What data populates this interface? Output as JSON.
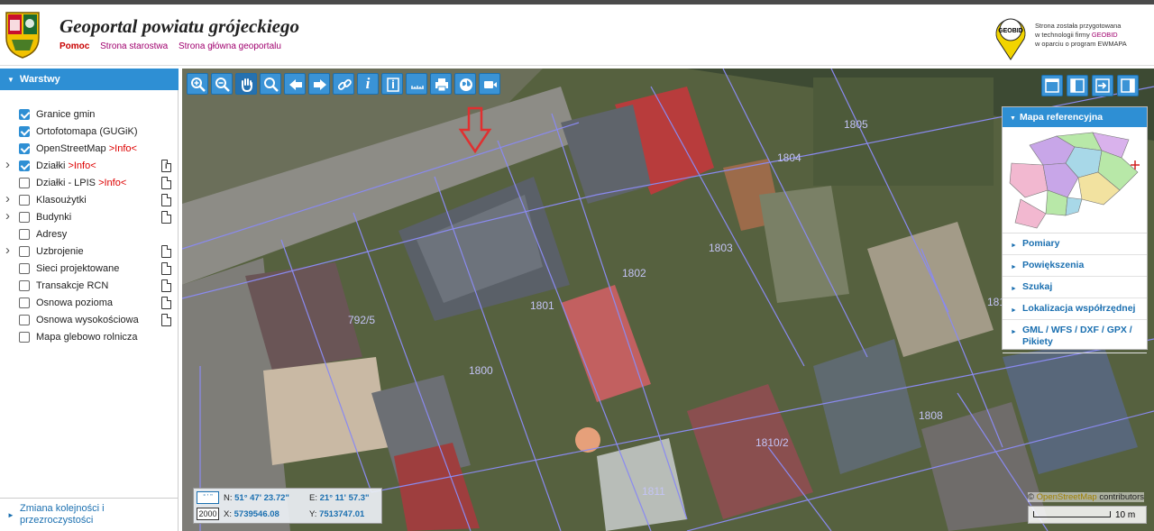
{
  "header": {
    "title": "Geoportal powiatu grójeckiego",
    "links": [
      "Pomoc",
      "Strona starostwa",
      "Strona główna geoportalu"
    ],
    "geobid_line1": "Strona została przygotowana",
    "geobid_line2_prefix": "w technologii firmy ",
    "geobid_brand": "GEOBID",
    "geobid_line3": "w oparciu o program EWMAPA",
    "geobid_logo_text": "GEOBID"
  },
  "sidebar": {
    "header": "Warstwy",
    "layers": [
      {
        "label": "Granice gmin",
        "info": "",
        "checked": true,
        "expandable": false,
        "doc": "none"
      },
      {
        "label": "Ortofotomapa (GUGiK)",
        "info": "",
        "checked": true,
        "expandable": false,
        "doc": "none"
      },
      {
        "label": "OpenStreetMap ",
        "info": ">Info<",
        "checked": true,
        "expandable": false,
        "doc": "none"
      },
      {
        "label": "Działki ",
        "info": ">Info<",
        "checked": true,
        "expandable": true,
        "doc": "info"
      },
      {
        "label": "Działki - LPIS ",
        "info": ">Info<",
        "checked": false,
        "expandable": false,
        "doc": "doc"
      },
      {
        "label": "Klasoużytki",
        "info": "",
        "checked": false,
        "expandable": true,
        "doc": "doc"
      },
      {
        "label": "Budynki",
        "info": "",
        "checked": false,
        "expandable": true,
        "doc": "doc"
      },
      {
        "label": "Adresy",
        "info": "",
        "checked": false,
        "expandable": false,
        "doc": "none"
      },
      {
        "label": "Uzbrojenie",
        "info": "",
        "checked": false,
        "expandable": true,
        "doc": "doc"
      },
      {
        "label": "Sieci projektowane",
        "info": "",
        "checked": false,
        "expandable": false,
        "doc": "doc"
      },
      {
        "label": "Transakcje RCN",
        "info": "",
        "checked": false,
        "expandable": false,
        "doc": "doc"
      },
      {
        "label": "Osnowa pozioma",
        "info": "",
        "checked": false,
        "expandable": false,
        "doc": "doc"
      },
      {
        "label": "Osnowa wysokościowa",
        "info": "",
        "checked": false,
        "expandable": false,
        "doc": "doc"
      },
      {
        "label": "Mapa glebowo rolnicza",
        "info": "",
        "checked": false,
        "expandable": false,
        "doc": "none"
      }
    ],
    "order_button_line1": "Zmiana kolejności i",
    "order_button_line2": "przezroczystości"
  },
  "toolbar": {
    "tools": [
      "zoom-in-icon",
      "zoom-out-icon",
      "pan-hand-icon",
      "zoom-window-icon",
      "back-arrow-icon",
      "forward-arrow-icon",
      "link-icon",
      "info-icon",
      "info-list-icon",
      "measure-icon",
      "print-icon",
      "globe-icon",
      "video-icon"
    ],
    "info_glyph": "i"
  },
  "view_buttons": [
    "layout-full-icon",
    "layout-left-icon",
    "layout-export-icon",
    "layout-right-icon"
  ],
  "reference_panel": {
    "header": "Mapa referencyjna",
    "items": [
      "Pomiary",
      "Powiększenia",
      "Szukaj",
      "Lokalizacja współrzędnej",
      "GML / WFS / DXF / GPX / Pikiety"
    ]
  },
  "coordinates": {
    "format_label": "° ' \"",
    "scale_value": "2000",
    "n_label": "N:",
    "n_value": "51° 47' 23.72\"",
    "e_label": "E:",
    "e_value": "21° 11' 57.3\"",
    "x_label": "X:",
    "x_value": "5739546.08",
    "y_label": "Y:",
    "y_value": "7513747.01"
  },
  "attribution": {
    "prefix": "© ",
    "osm": "OpenStreetMap",
    "suffix": " contributors"
  },
  "scalebar": {
    "label": "10 m"
  },
  "parcels": [
    "1805",
    "1804",
    "1803",
    "1802",
    "1801",
    "792/5",
    "1800",
    "181",
    "1810/2",
    "1811",
    "1808"
  ],
  "colors": {
    "accent": "#2e8fd4",
    "info": "#dd0000",
    "link": "#a0006e",
    "parcel_line": "#8a8af0",
    "marker": "#e03030"
  }
}
